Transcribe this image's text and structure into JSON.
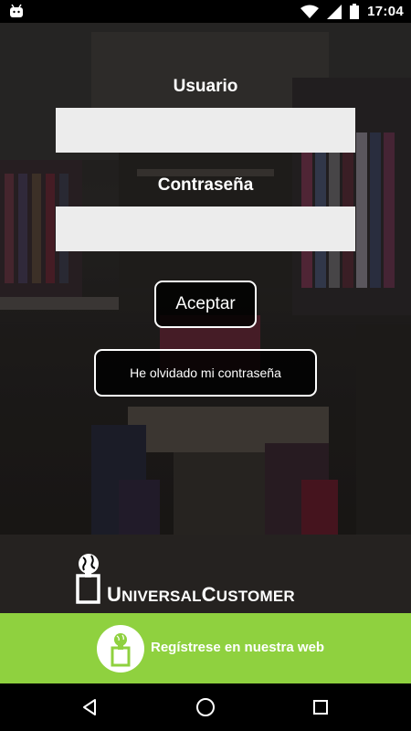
{
  "status_bar": {
    "time": "17:04",
    "icons": [
      "android-debug-icon",
      "wifi-icon",
      "signal-icon",
      "battery-icon"
    ]
  },
  "login": {
    "username_label": "Usuario",
    "username_value": "",
    "password_label": "Contraseña",
    "password_value": "",
    "accept_label": "Aceptar",
    "forgot_label": "He olvidado mi contraseña"
  },
  "brand": {
    "name_part1": "U",
    "name_part2": "NIVERSAL",
    "name_part3": "C",
    "name_part4": "USTOMER"
  },
  "register": {
    "label": "Regístrese en nuestra web",
    "color": "#8fd13f"
  },
  "nav": {
    "icons": [
      "back-icon",
      "home-icon",
      "recents-icon"
    ]
  }
}
